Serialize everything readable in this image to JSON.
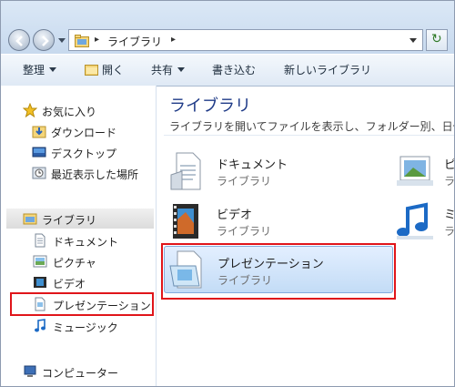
{
  "breadcrumb": {
    "root_sep": "▸",
    "current": "ライブラリ",
    "trail_sep": "▸"
  },
  "toolbar": {
    "organize": "整理",
    "open": "開く",
    "share": "共有",
    "burn": "書き込む",
    "new_library": "新しいライブラリ"
  },
  "nav": {
    "favorites": {
      "label": "お気に入り",
      "items": [
        {
          "label": "ダウンロード"
        },
        {
          "label": "デスクトップ"
        },
        {
          "label": "最近表示した場所"
        }
      ]
    },
    "libraries": {
      "label": "ライブラリ",
      "items": [
        {
          "label": "ドキュメント"
        },
        {
          "label": "ピクチャ"
        },
        {
          "label": "ビデオ"
        },
        {
          "label": "プレゼンテーション"
        },
        {
          "label": "ミュージック"
        }
      ]
    },
    "computer": {
      "label": "コンピューター"
    }
  },
  "content": {
    "title": "ライブラリ",
    "subtitle": "ライブラリを開いてファイルを表示し、フォルダー別、日付別",
    "tiles": [
      {
        "name": "ドキュメント",
        "kind": "ライブラリ"
      },
      {
        "name": "ビデオ",
        "kind": "ライブラリ"
      },
      {
        "name": "プレゼンテーション",
        "kind": "ライブラリ"
      },
      {
        "name": "ピ",
        "kind": "ラ"
      },
      {
        "name": "ミ",
        "kind": "ラ"
      }
    ]
  },
  "colors": {
    "highlight": "#e0151a",
    "title": "#1e3a87",
    "selected_tile": "#c3dcf6"
  }
}
